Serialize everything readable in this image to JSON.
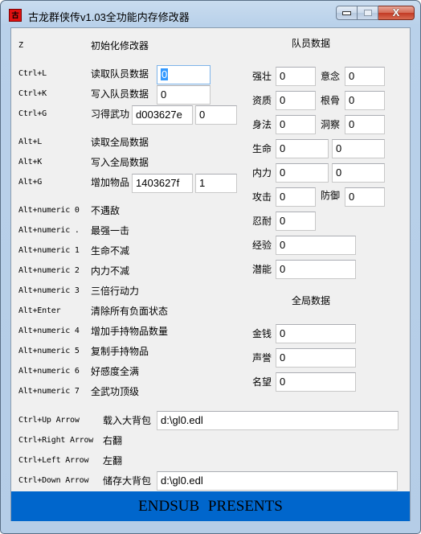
{
  "window": {
    "title": "古龙群侠传v1.03全功能内存修改器",
    "icon": "app-icon",
    "icon_glyph": "古",
    "buttons": {
      "minimize": "minimize-icon",
      "maximize": "maximize-icon",
      "close_glyph": "X"
    }
  },
  "hotkeys": [
    {
      "key": "Z",
      "label": "初始化修改器"
    },
    {
      "key": "Ctrl+L",
      "label": "读取队员数据",
      "inputs": [
        {
          "value": "0",
          "selected": true
        }
      ]
    },
    {
      "key": "Ctrl+K",
      "label": "写入队员数据",
      "inputs": [
        {
          "value": "0"
        }
      ]
    },
    {
      "key": "Ctrl+G",
      "label": "习得武功",
      "inputs": [
        {
          "value": "d003627e"
        },
        {
          "value": "0"
        }
      ]
    },
    {
      "key": "Alt+L",
      "label": "读取全局数据"
    },
    {
      "key": "Alt+K",
      "label": "写入全局数据"
    },
    {
      "key": "Alt+G",
      "label": "增加物品",
      "inputs": [
        {
          "value": "1403627f"
        },
        {
          "value": "1"
        }
      ]
    },
    {
      "key": "Alt+numeric 0",
      "label": "不遇敌"
    },
    {
      "key": "Alt+numeric .",
      "label": "最强一击"
    },
    {
      "key": "Alt+numeric 1",
      "label": "生命不减"
    },
    {
      "key": "Alt+numeric 2",
      "label": "内力不减"
    },
    {
      "key": "Alt+numeric 3",
      "label": "三倍行动力"
    },
    {
      "key": "Alt+Enter",
      "label": "清除所有负面状态"
    },
    {
      "key": "Alt+numeric 4",
      "label": "增加手持物品数量"
    },
    {
      "key": "Alt+numeric 5",
      "label": "复制手持物品"
    },
    {
      "key": "Alt+numeric 6",
      "label": "好感度全满"
    },
    {
      "key": "Alt+numeric 7",
      "label": "全武功顶级"
    }
  ],
  "backpack": [
    {
      "key": "Ctrl+Up Arrow",
      "label": "载入大背包",
      "value": "d:\\gl0.edl"
    },
    {
      "key": "Ctrl+Right Arrow",
      "label": "右翻"
    },
    {
      "key": "Ctrl+Left Arrow",
      "label": "左翻"
    },
    {
      "key": "Ctrl+Down Arrow",
      "label": "储存大背包",
      "value": "d:\\gl0.edl"
    }
  ],
  "member_data": {
    "heading": "队员数据",
    "stats": {
      "strength": {
        "label": "强壮",
        "value": "0"
      },
      "will": {
        "label": "意念",
        "value": "0"
      },
      "aptitude": {
        "label": "资质",
        "value": "0"
      },
      "bone": {
        "label": "根骨",
        "value": "0"
      },
      "agility": {
        "label": "身法",
        "value": "0"
      },
      "insight": {
        "label": "洞察",
        "value": "0"
      },
      "life": {
        "label": "生命",
        "value": "0",
        "max": "0"
      },
      "inner_power": {
        "label": "内力",
        "value": "0",
        "max": "0"
      },
      "attack": {
        "label": "攻击",
        "value": "0"
      },
      "defense": {
        "label": "防御",
        "value": "0"
      },
      "endurance": {
        "label": "忍耐",
        "value": "0"
      },
      "experience": {
        "label": "经验",
        "value": "0"
      },
      "potential": {
        "label": "潜能",
        "value": "0"
      }
    }
  },
  "global_data": {
    "heading": "全局数据",
    "money": {
      "label": "金钱",
      "value": "0"
    },
    "reputation": {
      "label": "声誉",
      "value": "0"
    },
    "fame": {
      "label": "名望",
      "value": "0"
    }
  },
  "banner": {
    "text": "ENDSUB PRESENTS",
    "color": "#0066cc"
  }
}
